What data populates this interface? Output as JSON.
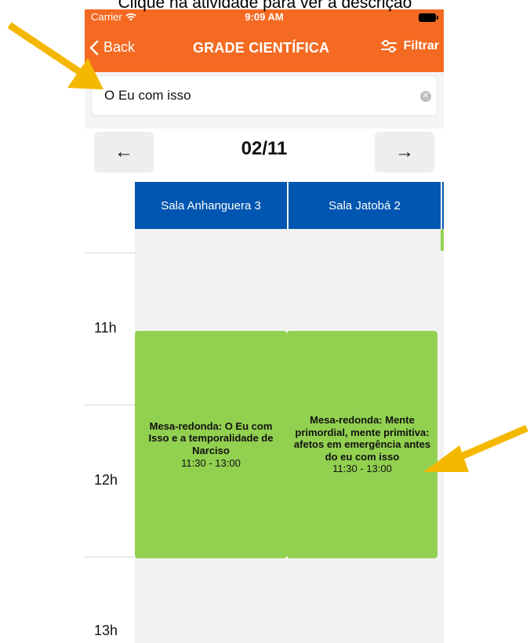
{
  "caption": "Clique na atividade para ver a descrição",
  "status_bar": {
    "carrier": "Carrier",
    "time": "9:09 AM"
  },
  "nav": {
    "back_label": "Back",
    "title": "GRADE CIENTÍFICA",
    "filter_label": "Filtrar",
    "back_icon": "chevron-left-icon",
    "filter_icon": "sliders-icon"
  },
  "search": {
    "value": "O Eu com isso",
    "clear_icon": "clear-icon"
  },
  "date_nav": {
    "prev_icon": "arrow-left-icon",
    "date": "02/11",
    "next_icon": "arrow-right-icon"
  },
  "hours": [
    "11h",
    "12h",
    "13h"
  ],
  "rooms": [
    "Sala Anhanguera 3",
    "Sala Jatobá 2"
  ],
  "events": [
    {
      "title": "Mesa-redonda: O Eu com Isso e a temporalidade de Narciso",
      "time": "11:30 - 13:00"
    },
    {
      "title": "Mesa-redonda: Mente primordial, mente primitiva: afetos em emergência antes do eu com isso",
      "time": "11:30 - 13:00"
    }
  ],
  "colors": {
    "header_orange": "#f46a22",
    "room_blue": "#0056b0",
    "event_green": "#92d050",
    "annotation_arrow": "#f5b800"
  }
}
